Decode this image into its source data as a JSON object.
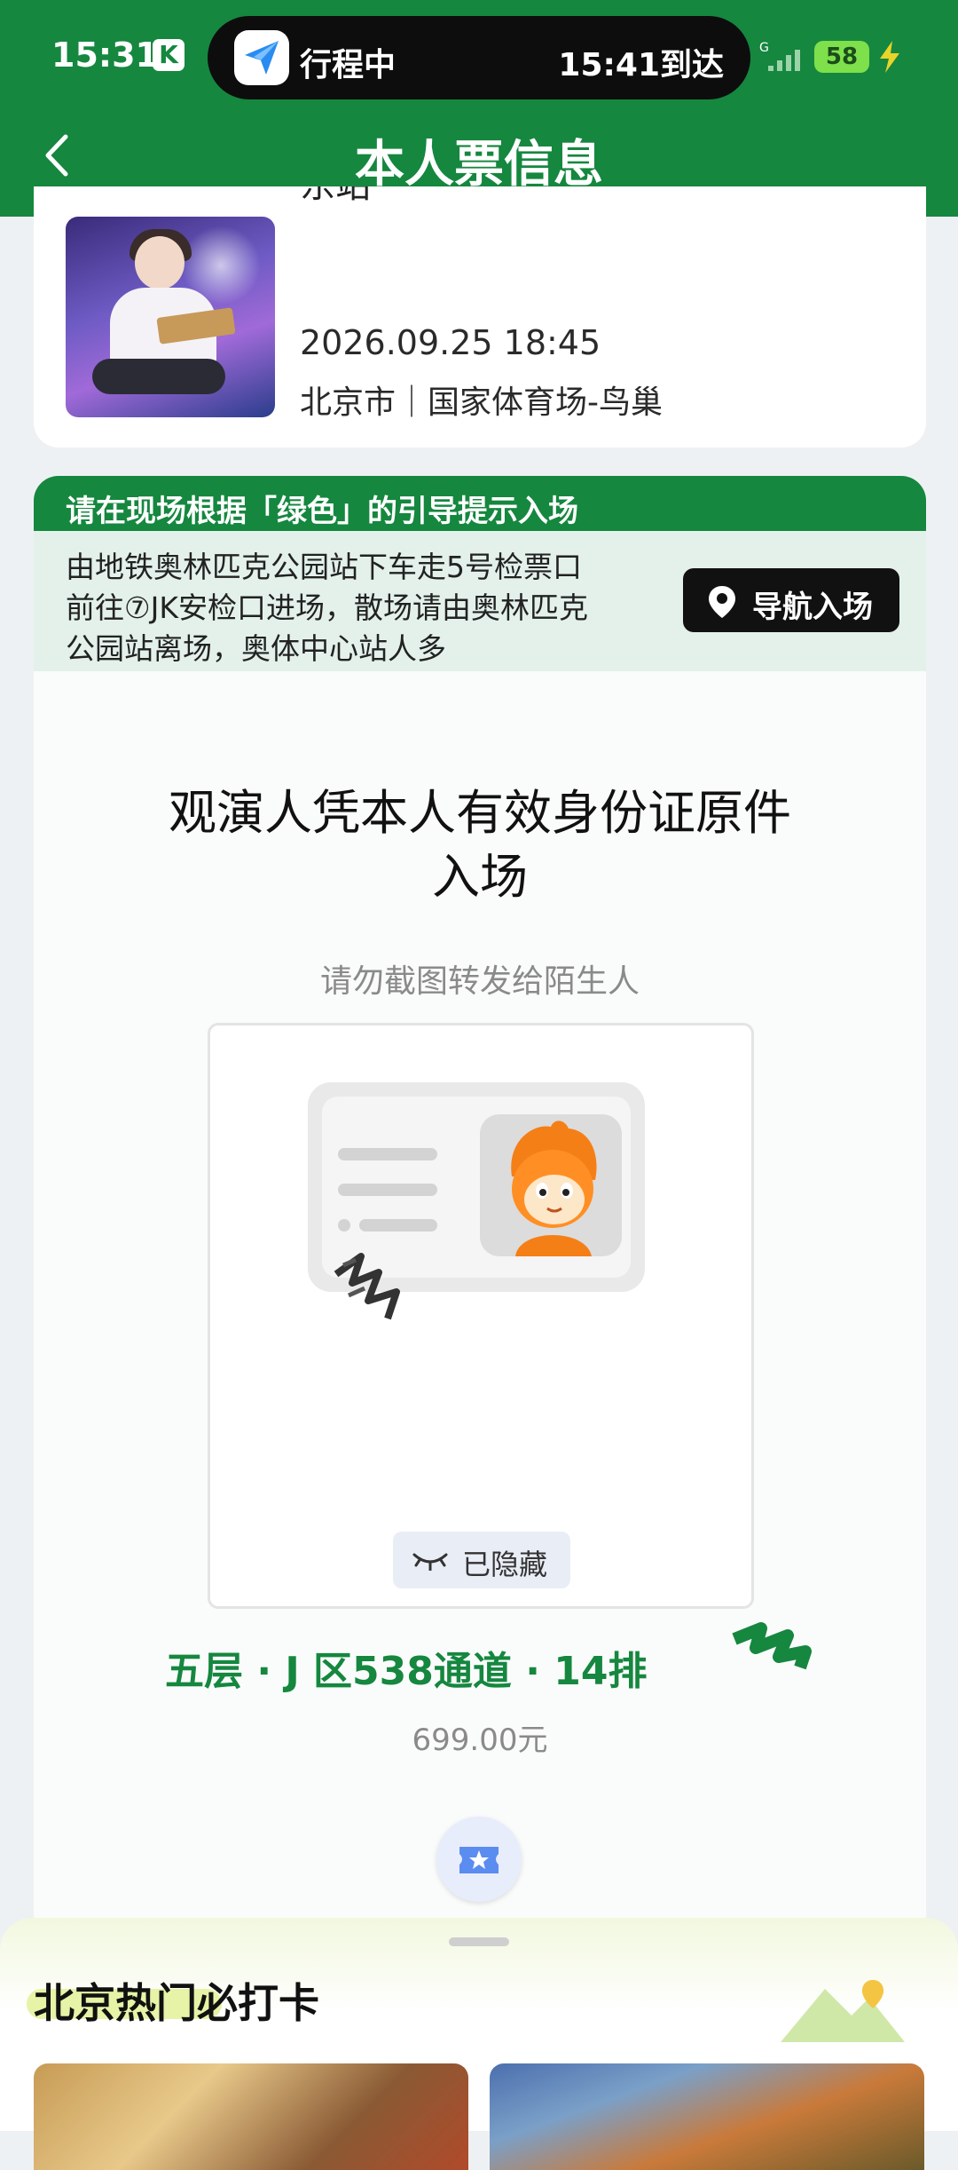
{
  "status_bar": {
    "time": "15:31",
    "k_badge": "K",
    "island_status": "行程中",
    "island_arrive": "15:41到达",
    "network": "G",
    "battery": "58"
  },
  "header": {
    "title": "本人票信息"
  },
  "event": {
    "title_fragment": "东站",
    "datetime": "2026.09.25 18:45",
    "venue": "北京市｜国家体育场-鸟巢"
  },
  "entry": {
    "title": "请在现场根据「绿色」的引导提示入场",
    "description_lines": [
      "由地铁奥林匹克公园站下车走5号检票口",
      "前往⑦JK安检口进场，散场请由奥林匹克",
      "公园站离场，奥体中心站人多"
    ],
    "nav_button": "导航入场"
  },
  "ticket": {
    "title_lines": [
      "观演人凭本人有效身份证原件",
      "入场"
    ],
    "warning": "请勿截图转发给陌生人",
    "hidden_label": "已隐藏",
    "seat": "五层 · J 区538通道 · 14排",
    "price": "699.00元"
  },
  "sheet": {
    "title": "北京热门必打卡"
  },
  "colors": {
    "brand_green": "#15873f",
    "dark": "#111111"
  }
}
